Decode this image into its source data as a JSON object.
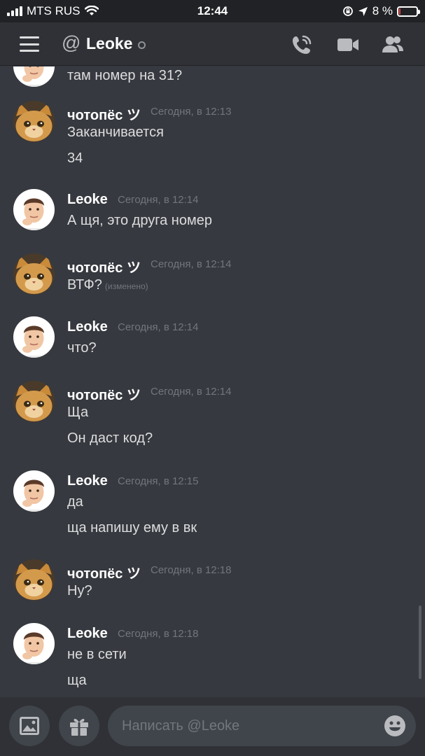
{
  "status_bar": {
    "carrier": "MTS RUS",
    "time": "12:44",
    "battery_percent": "8 %",
    "battery_level": 0.08,
    "icons": [
      "signal-icon",
      "wifi-icon",
      "orientation-lock-icon",
      "location-icon",
      "battery-icon"
    ]
  },
  "header": {
    "menu_icon": "hamburger-menu-icon",
    "at_symbol": "@",
    "title": "Leoke",
    "status": "offline",
    "actions": [
      "phone-call-icon",
      "video-call-icon",
      "members-icon"
    ]
  },
  "messages": [
    {
      "author": "",
      "timestamp": "",
      "lines": [
        "там номер на 31?"
      ],
      "avatar": "memoji"
    },
    {
      "author": "чотопёс ツ",
      "timestamp": "Сегодня, в 12:13",
      "lines": [
        "Заканчивается",
        "34"
      ],
      "avatar": "cat"
    },
    {
      "author": "Leoke",
      "timestamp": "Сегодня, в 12:14",
      "lines": [
        "А щя, это друга номер"
      ],
      "avatar": "memoji"
    },
    {
      "author": "чотопёс ツ",
      "timestamp": "Сегодня, в 12:14",
      "lines": [
        "ВТФ?"
      ],
      "edited": "(изменено)",
      "avatar": "cat"
    },
    {
      "author": "Leoke",
      "timestamp": "Сегодня, в 12:14",
      "lines": [
        "что?"
      ],
      "avatar": "memoji"
    },
    {
      "author": "чотопёс ツ",
      "timestamp": "Сегодня, в 12:14",
      "lines": [
        "Ща",
        "Он даст код?"
      ],
      "avatar": "cat"
    },
    {
      "author": "Leoke",
      "timestamp": "Сегодня, в 12:15",
      "lines": [
        "да",
        "ща напишу ему в вк"
      ],
      "avatar": "memoji"
    },
    {
      "author": "чотопёс ツ",
      "timestamp": "Сегодня, в 12:18",
      "lines": [
        "Ну?"
      ],
      "avatar": "cat"
    },
    {
      "author": "Leoke",
      "timestamp": "Сегодня, в 12:18",
      "lines": [
        "не в сети",
        "ща"
      ],
      "avatar": "memoji"
    }
  ],
  "composer": {
    "placeholder": "Написать @Leoke",
    "value": "",
    "buttons": [
      "image-upload-icon",
      "gift-icon",
      "emoji-icon"
    ]
  }
}
